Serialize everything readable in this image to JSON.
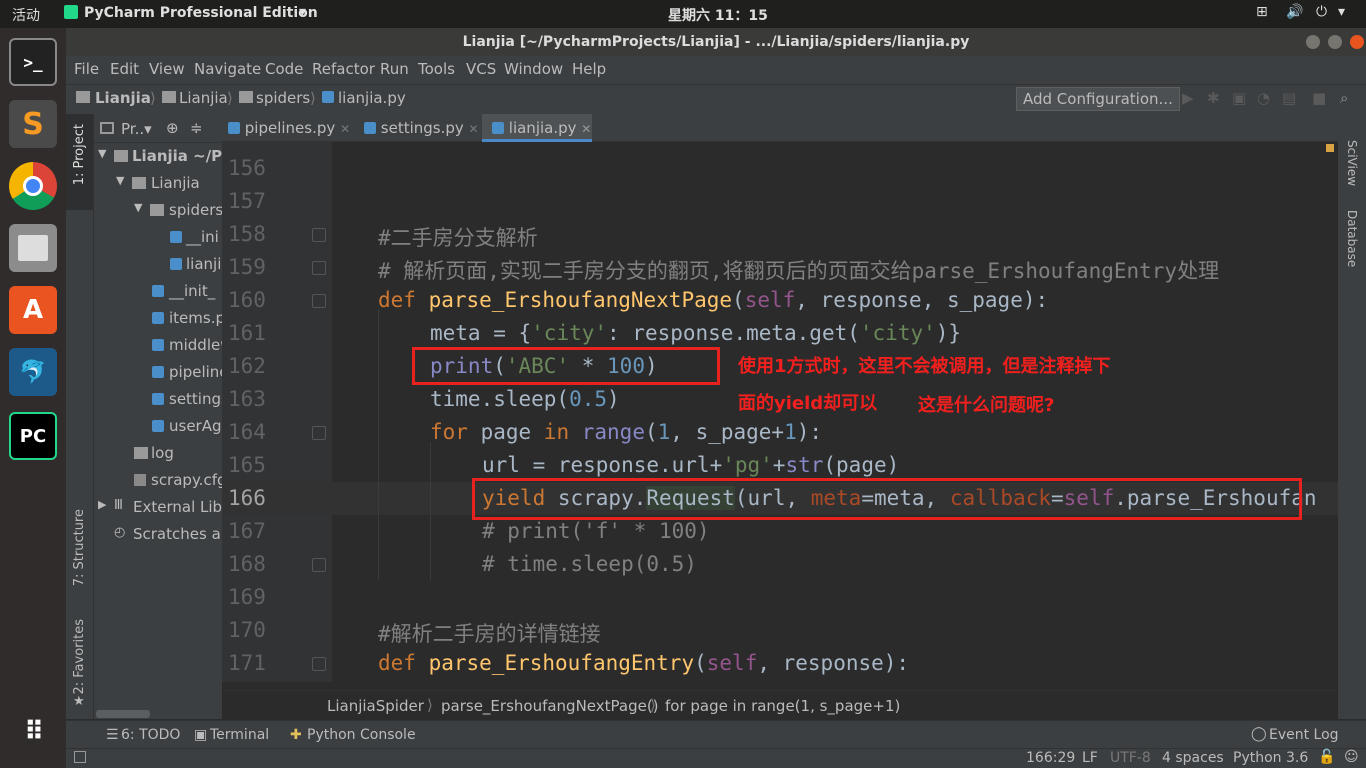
{
  "topbar": {
    "activities": "活动",
    "app_name": "PyCharm Professional Edition",
    "clock": "星期六 11：15"
  },
  "window": {
    "title": "Lianjia [~/PycharmProjects/Lianjia] - .../Lianjia/spiders/lianjia.py"
  },
  "menu": [
    "File",
    "Edit",
    "View",
    "Navigate",
    "Code",
    "Refactor",
    "Run",
    "Tools",
    "VCS",
    "Window",
    "Help"
  ],
  "navbar": {
    "crumbs": [
      "Lianjia",
      "Lianjia",
      "spiders",
      "lianjia.py"
    ],
    "add_config": "Add Configuration..."
  },
  "project_panel": {
    "title": "Pr..▾",
    "items": [
      "Lianjia ~/Py",
      "Lianjia",
      "spiders",
      "__ini",
      "lianji",
      "__init_",
      "items.p",
      "middlew",
      "pipeline",
      "settings",
      "userAge",
      "log",
      "scrapy.cfg",
      "External Libr",
      "Scratches an"
    ]
  },
  "tool_windows": {
    "project": "1: Project",
    "structure": "7: Structure",
    "favorites": "2: Favorites",
    "sciview": "SciView",
    "database": "Database"
  },
  "tabs": [
    "pipelines.py",
    "settings.py",
    "lianjia.py"
  ],
  "editor": {
    "line_numbers": [
      "156",
      "157",
      "158",
      "159",
      "160",
      "161",
      "162",
      "163",
      "164",
      "165",
      "166",
      "167",
      "168",
      "169",
      "170",
      "171"
    ],
    "lines": {
      "l158": "#二手房分支解析",
      "l159": "# 解析页面,实现二手房分支的翻页,将翻页后的页面交给parse_ErshoufangEntry处理",
      "l160": {
        "def": "def",
        "name": "parse_ErshoufangNextPage",
        "open": "(",
        "self": "self",
        "rest": ", response, s_page):"
      },
      "l161": {
        "a": "meta = {",
        "s1": "'city'",
        "b": ": response.meta.get(",
        "s2": "'city'",
        "c": ")}"
      },
      "l162": {
        "fn": "print",
        "a": "(",
        "s": "'ABC'",
        "b": " * ",
        "n": "100",
        "c": ")"
      },
      "l163": {
        "a": "time.sleep(",
        "n": "0.5",
        "c": ")"
      },
      "l164": {
        "kw1": "for",
        "a": " page ",
        "kw2": "in",
        "sp": " ",
        "bi": "range",
        "b": "(",
        "n1": "1",
        "c": ", s_page+",
        "n2": "1",
        "d": "):"
      },
      "l165": {
        "a": "url = response.url+",
        "s": "'pg'",
        "b": "+",
        "bi": "str",
        "c": "(page)"
      },
      "l166": {
        "kw": "yield",
        "a": " scrapy.",
        "req": "Request",
        "b": "(url, ",
        "p1": "meta",
        "c": "=meta, ",
        "p2": "callback",
        "d": "=",
        "slf": "self",
        "e": ".parse_Ershoufan"
      },
      "l167": "# print('f' * 100)",
      "l168": "# time.sleep(0.5)",
      "l170": "#解析二手房的详情链接",
      "l171": {
        "def": "def",
        "name": "parse_ErshoufangEntry",
        "open": "(",
        "self": "self",
        "rest": ", response):"
      }
    }
  },
  "annotations": [
    "使用1方式时，这里不会被调用，但是注释掉下",
    "面的yield却可以",
    "这是什么问题呢?"
  ],
  "breadcrumb": [
    "LianjiaSpider",
    "parse_ErshoufangNextPage()",
    "for page in range(1, s_page+1)"
  ],
  "bottom_tools": {
    "todo": "6: TODO",
    "terminal": "Terminal",
    "python_console": "Python Console",
    "event_log": "Event Log"
  },
  "status": {
    "position": "166:29",
    "line_sep": "LF",
    "encoding": "UTF-8",
    "indent": "4 spaces",
    "interpreter": "Python 3.6"
  }
}
